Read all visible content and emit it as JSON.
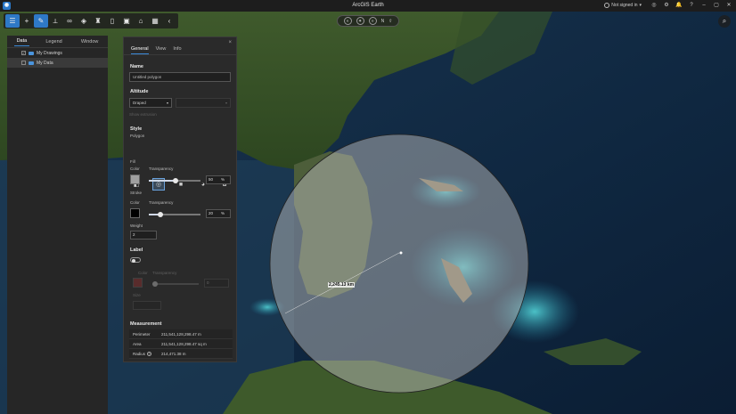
{
  "app": {
    "title": "ArcGIS Earth",
    "signin": "Not signed in"
  },
  "toolbar": {
    "collapse": "‹"
  },
  "nav": {
    "left": "«",
    "right": "»",
    "extra": "N"
  },
  "left_panel": {
    "tabs": [
      "Data",
      "Legend",
      "Window"
    ],
    "items": [
      {
        "label": "My Drawings",
        "checked": "✓"
      },
      {
        "label": "My Data",
        "checked": ""
      }
    ]
  },
  "props": {
    "tabs": [
      "General",
      "View",
      "Info"
    ],
    "name_label": "Name",
    "name_value": "Untitled polygon",
    "altitude_label": "Altitude",
    "altitude_value": "Draped",
    "extrude_label": "Show extrusion",
    "style_label": "Style",
    "polygon_label": "Polygon",
    "fill_label": "Fill",
    "color_label": "Color",
    "transparency_label": "Transparency",
    "fill_transparency": "50",
    "pct": "%",
    "stroke_label": "Stroke",
    "stroke_transparency": "20",
    "weight_label": "Weight",
    "weight_value": "2",
    "label_label": "Label",
    "label_color": "Color",
    "label_transparency": "Transparency",
    "label_size": "Size",
    "label_transparency_value": "0",
    "measurement_label": "Measurement",
    "measure": [
      {
        "k": "Perimeter",
        "v": "211,541,128,298.47 m"
      },
      {
        "k": "Area",
        "v": "211,541,128,298.47 sq m"
      },
      {
        "k": "Radius",
        "v": "214,471.38 m"
      }
    ],
    "fill_color": "#a0a0a0",
    "stroke_color": "#000000"
  },
  "map": {
    "label": "2,245.13 km"
  },
  "colors": {
    "accent": "#2e79c6",
    "panel": "#2a2a2a"
  }
}
